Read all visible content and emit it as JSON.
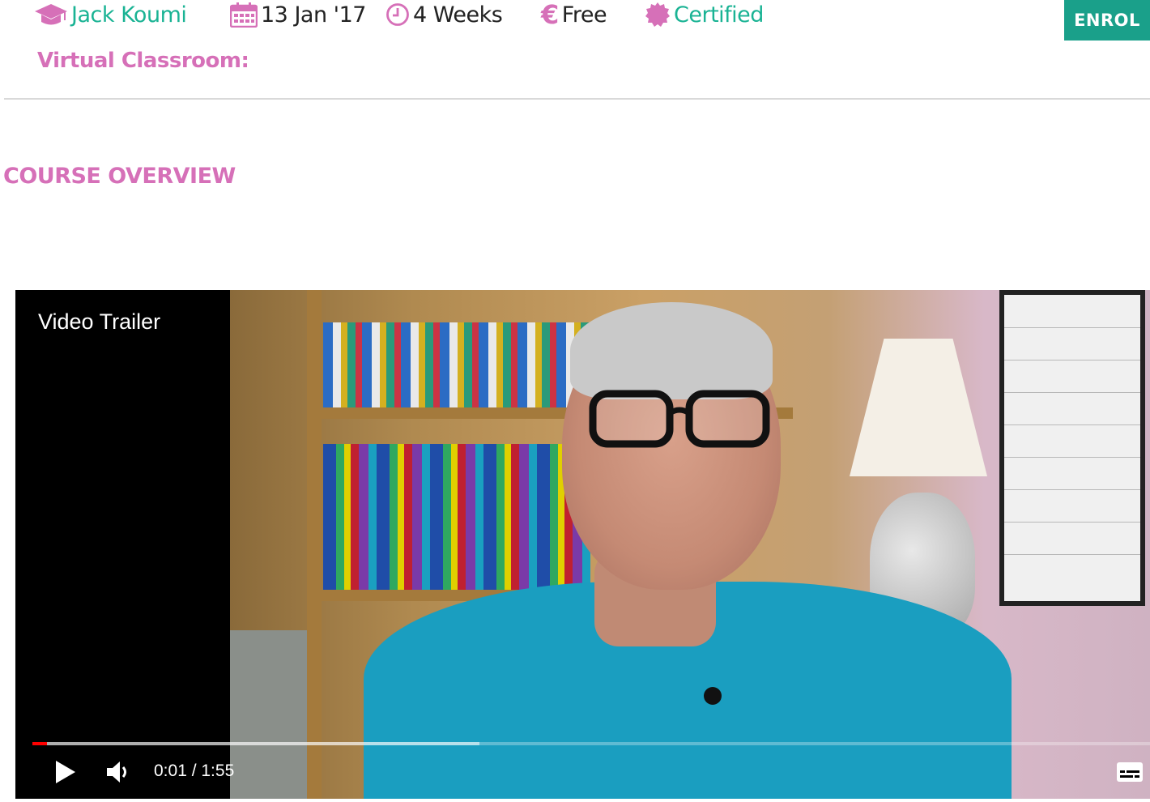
{
  "meta": {
    "instructor": "Jack Koumi",
    "date": "13 Jan '17",
    "duration": "4 Weeks",
    "price": "Free",
    "certificate": "Certified",
    "icons": [
      "graduation-cap-icon",
      "calendar-icon",
      "clock-icon",
      "euro-icon",
      "certificate-badge-icon"
    ]
  },
  "header": {
    "enrol_label": "ENROL"
  },
  "virtual_classroom_label": "Virtual Classroom:",
  "section_title": "COURSE OVERVIEW",
  "video": {
    "title": "Video Trailer",
    "time_display": "0:01 / 1:55",
    "played_fraction": 0.009,
    "buffered_fraction": 0.4,
    "controls": [
      "play-icon",
      "volume-icon",
      "subtitles-icon"
    ]
  },
  "colors": {
    "teal": "#1ab394",
    "pink": "#d670b8",
    "enrol_bg": "#1aa08a",
    "progress_red": "#ff0000"
  }
}
